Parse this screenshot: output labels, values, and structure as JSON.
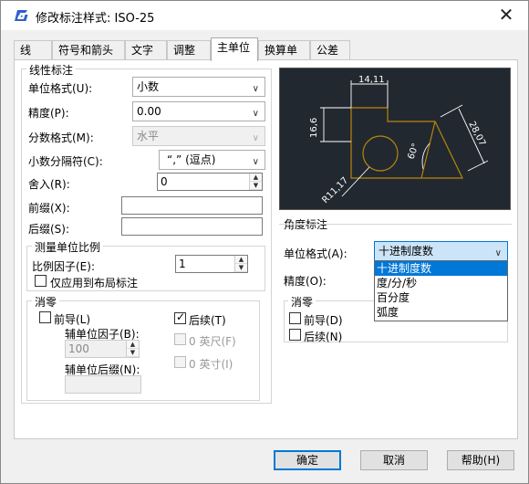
{
  "window": {
    "title": "修改标注样式: ISO-25"
  },
  "tabs": [
    "线",
    "符号和箭头",
    "文字",
    "调整",
    "主单位",
    "换算单位",
    "公差"
  ],
  "linear": {
    "group_label": "线性标注",
    "unit_format_label": "单位格式(U):",
    "unit_format_value": "小数",
    "precision_label": "精度(P):",
    "precision_value": "0.00",
    "fraction_format_label": "分数格式(M):",
    "fraction_format_value": "水平",
    "decimal_sep_label": "小数分隔符(C):",
    "decimal_sep_value": "“,” (逗点)",
    "round_label": "舍入(R):",
    "round_value": "0",
    "prefix_label": "前缀(X):",
    "prefix_value": "",
    "suffix_label": "后缀(S):",
    "suffix_value": ""
  },
  "scale": {
    "group_label": "测量单位比例",
    "factor_label": "比例因子(E):",
    "factor_value": "1",
    "layout_only_label": "仅应用到布局标注"
  },
  "zero_linear": {
    "group_label": "消零",
    "leading_label": "前导(L)",
    "trailing_label": "后续(T)",
    "sub_factor_label": "辅单位因子(B):",
    "sub_factor_value": "100",
    "sub_suffix_label": "辅单位后缀(N):",
    "feet_label": "0 英尺(F)",
    "inches_label": "0 英寸(I)"
  },
  "preview": {
    "dim_top": "14,11",
    "dim_left": "16,6",
    "dim_right": "28,07",
    "dim_angle": "60°",
    "dim_radius": "R11,17"
  },
  "angular": {
    "group_label": "角度标注",
    "unit_format_label": "单位格式(A):",
    "unit_format_value": "十进制度数",
    "precision_label": "精度(O):",
    "options": [
      "十进制度数",
      "度/分/秒",
      "百分度",
      "弧度"
    ]
  },
  "zero_angular": {
    "group_label": "消零",
    "leading_label": "前导(D)",
    "trailing_label": "后续(N)"
  },
  "buttons": {
    "ok": "确定",
    "cancel": "取消",
    "help": "帮助(H)"
  }
}
